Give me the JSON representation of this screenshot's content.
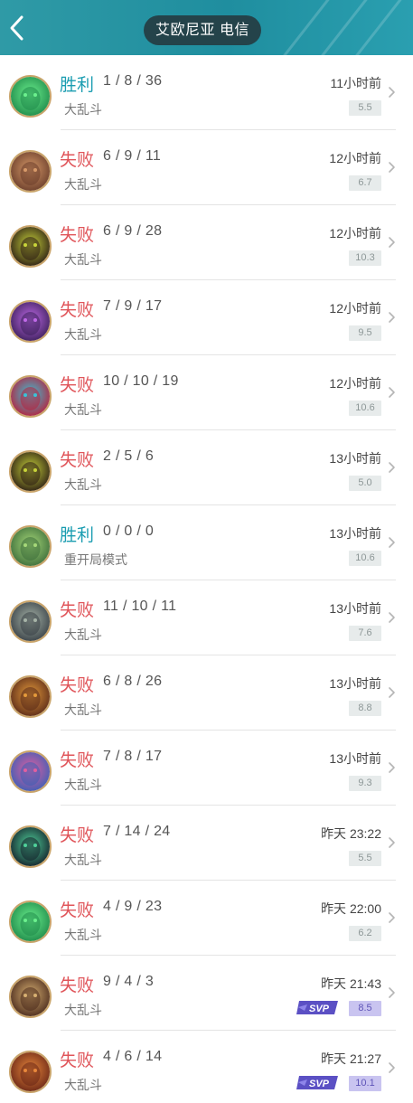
{
  "header": {
    "server": "艾欧尼亚 电信"
  },
  "matches": [
    {
      "result": "胜利",
      "outcome": "win",
      "kda": "1 / 8 / 36",
      "mode": "大乱斗",
      "time": "11小时前",
      "score": "5.5",
      "svp": false,
      "avatar_color": "#1f8a4a",
      "avatar_accent": "#6cf08e"
    },
    {
      "result": "失败",
      "outcome": "lose",
      "kda": "6 / 9 / 11",
      "mode": "大乱斗",
      "time": "12小时前",
      "score": "6.7",
      "svp": false,
      "avatar_color": "#6a3d2a",
      "avatar_accent": "#d79a6a"
    },
    {
      "result": "失败",
      "outcome": "lose",
      "kda": "6 / 9 / 28",
      "mode": "大乱斗",
      "time": "12小时前",
      "score": "10.3",
      "svp": false,
      "avatar_color": "#2b1c14",
      "avatar_accent": "#c8d43a"
    },
    {
      "result": "失败",
      "outcome": "lose",
      "kda": "7 / 9 / 17",
      "mode": "大乱斗",
      "time": "12小时前",
      "score": "9.5",
      "svp": false,
      "avatar_color": "#3b1f5a",
      "avatar_accent": "#c06ae8"
    },
    {
      "result": "失败",
      "outcome": "lose",
      "kda": "10 / 10 / 19",
      "mode": "大乱斗",
      "time": "12小时前",
      "score": "10.6",
      "svp": false,
      "avatar_color": "#b8213c",
      "avatar_accent": "#39c3d8"
    },
    {
      "result": "失败",
      "outcome": "lose",
      "kda": "2 / 5 / 6",
      "mode": "大乱斗",
      "time": "13小时前",
      "score": "5.0",
      "svp": false,
      "avatar_color": "#2b1c14",
      "avatar_accent": "#c8d43a"
    },
    {
      "result": "胜利",
      "outcome": "win",
      "kda": "0 / 0 / 0",
      "mode": "重开局模式",
      "time": "13小时前",
      "score": "10.6",
      "svp": false,
      "avatar_color": "#3d6d3a",
      "avatar_accent": "#a6d879"
    },
    {
      "result": "失败",
      "outcome": "lose",
      "kda": "11 / 10 / 11",
      "mode": "大乱斗",
      "time": "13小时前",
      "score": "7.6",
      "svp": false,
      "avatar_color": "#384046",
      "avatar_accent": "#a7b4a8"
    },
    {
      "result": "失败",
      "outcome": "lose",
      "kda": "6 / 8 / 26",
      "mode": "大乱斗",
      "time": "13小时前",
      "score": "8.8",
      "svp": false,
      "avatar_color": "#5a2a18",
      "avatar_accent": "#e49a3b"
    },
    {
      "result": "失败",
      "outcome": "lose",
      "kda": "7 / 8 / 17",
      "mode": "大乱斗",
      "time": "13小时前",
      "score": "9.3",
      "svp": false,
      "avatar_color": "#3c5fb5",
      "avatar_accent": "#e25fa0"
    },
    {
      "result": "失败",
      "outcome": "lose",
      "kda": "7 / 14 / 24",
      "mode": "大乱斗",
      "time": "昨天 23:22",
      "score": "5.5",
      "svp": false,
      "avatar_color": "#14202a",
      "avatar_accent": "#4fd19a"
    },
    {
      "result": "失败",
      "outcome": "lose",
      "kda": "4 / 9 / 23",
      "mode": "大乱斗",
      "time": "昨天 22:00",
      "score": "6.2",
      "svp": false,
      "avatar_color": "#1f8a4a",
      "avatar_accent": "#6cf08e"
    },
    {
      "result": "失败",
      "outcome": "lose",
      "kda": "9 / 4 / 3",
      "mode": "大乱斗",
      "time": "昨天 21:43",
      "score": "8.5",
      "svp": true,
      "avatar_color": "#4a2a1c",
      "avatar_accent": "#d7b072"
    },
    {
      "result": "失败",
      "outcome": "lose",
      "kda": "4 / 6 / 14",
      "mode": "大乱斗",
      "time": "昨天 21:27",
      "score": "10.1",
      "svp": true,
      "avatar_color": "#6a2616",
      "avatar_accent": "#e8883c"
    }
  ],
  "svp_label": "SVP"
}
